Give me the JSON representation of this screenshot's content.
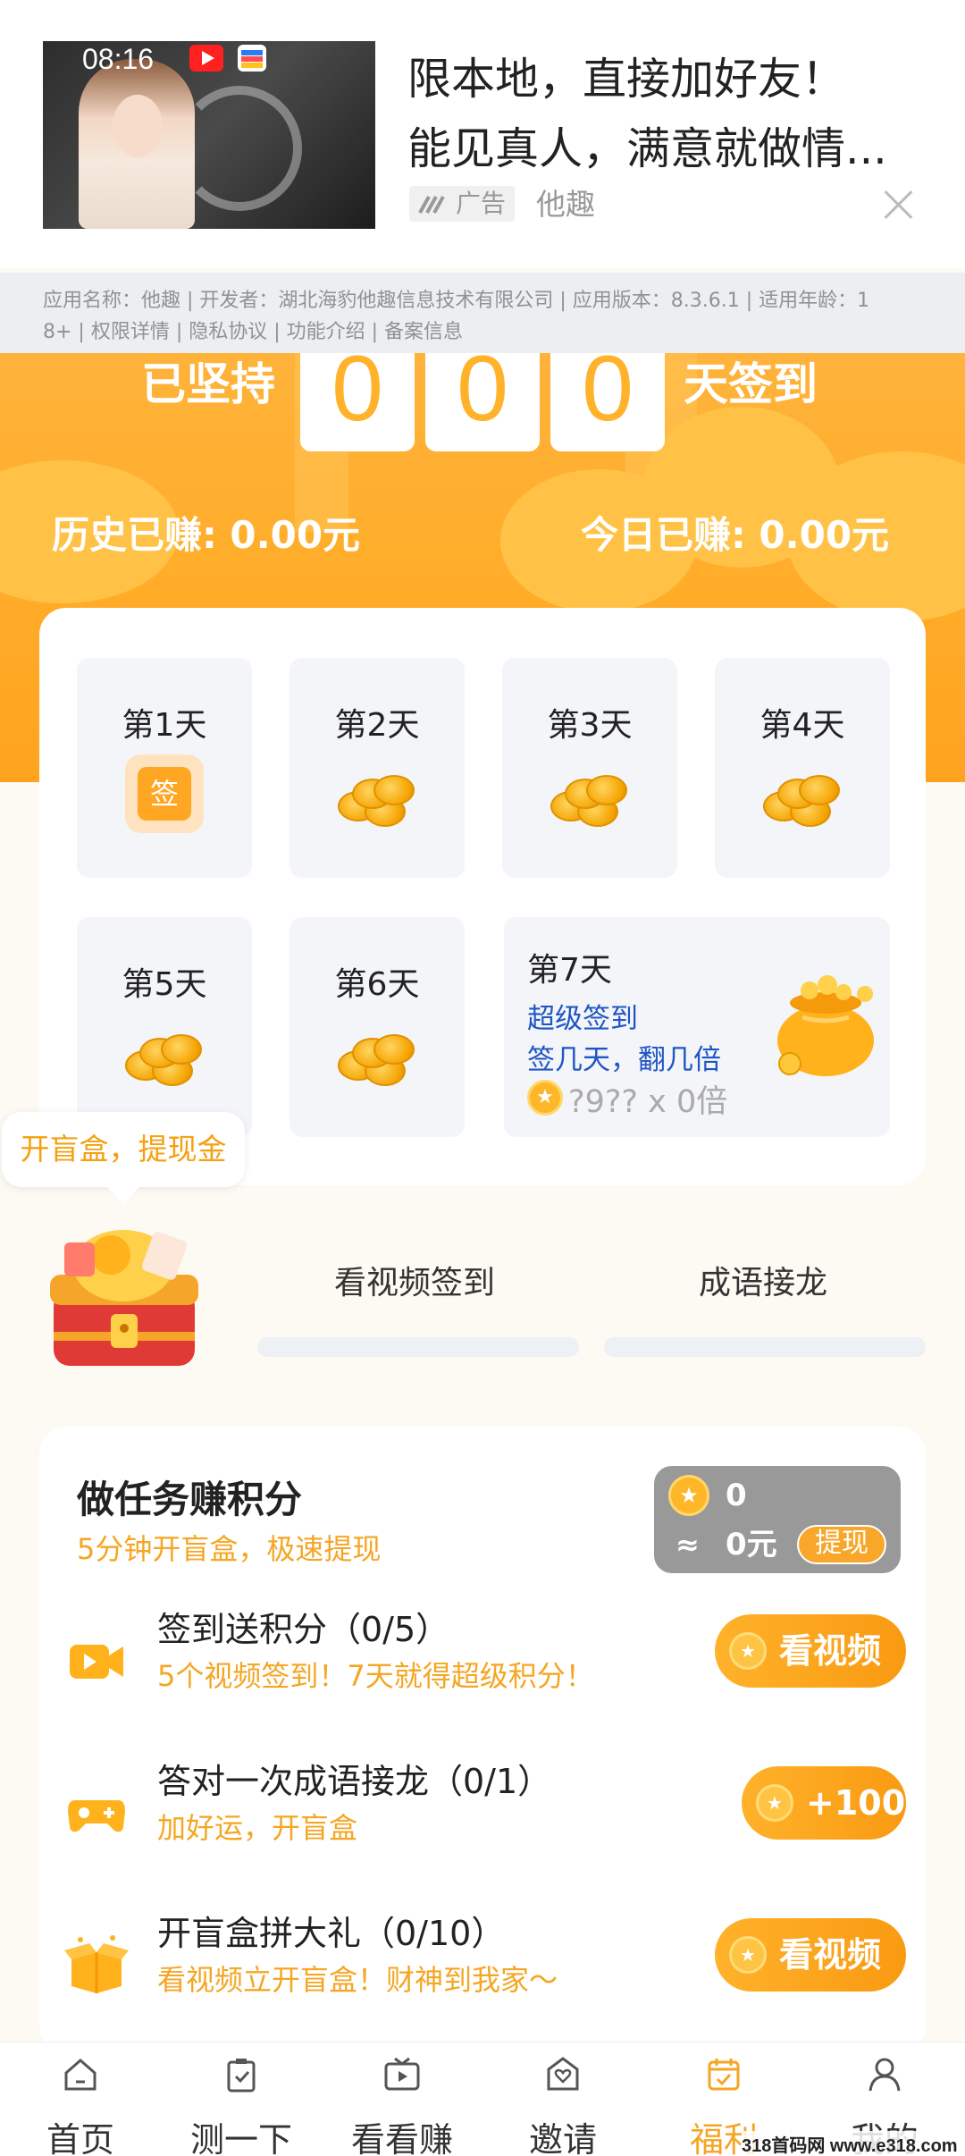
{
  "ad": {
    "time": "08:16",
    "title_line1": "限本地，直接加好友！",
    "title_line2": "能见真人，满意就做情...",
    "tag": "广告",
    "brand": "他趣",
    "info_line1": "应用名称：他趣 | 开发者：湖北海豹他趣信息技术有限公司 | 应用版本：8.3.6.1 | 适用年龄：1",
    "info_line2": "8+ | 权限详情 | 隐私协议 | 功能介绍 | 备案信息"
  },
  "streak": {
    "prefix": "已坚持",
    "digits": [
      "0",
      "0",
      "0"
    ],
    "suffix": "天签到",
    "history": "历史已赚: 0.00元",
    "today": "今日已赚: 0.00元"
  },
  "days": {
    "d1": "第1天",
    "d1_badge": "签",
    "d2": "第2天",
    "d3": "第3天",
    "d4": "第4天",
    "d5": "第5天",
    "d6": "第6天",
    "d7": "第7天",
    "d7_line1": "超级签到",
    "d7_line2": "签几天，翻几倍",
    "d7_line3": "?9?? x 0倍"
  },
  "blindbox": {
    "tooltip": "开盲盒，提现金",
    "tab1": "看视频签到",
    "tab2": "成语接龙"
  },
  "tasks": {
    "title": "做任务赚积分",
    "subtitle": "5分钟开盲盒，极速提现",
    "points": "0",
    "approx": "≈",
    "yuan": "0元",
    "withdraw": "提现",
    "items": [
      {
        "title": "签到送积分（0/5）",
        "sub": "5个视频签到！7天就得超级积分！",
        "btn": "看视频"
      },
      {
        "title": "答对一次成语接龙（0/1）",
        "sub": "加好运，开盲盒",
        "btn": "+100"
      },
      {
        "title": "开盲盒拼大礼（0/10）",
        "sub": "看视频立开盲盒！财神到我家～",
        "btn": "看视频"
      }
    ]
  },
  "nav": {
    "home": "首页",
    "test": "测一下",
    "watch": "看看赚",
    "invite": "邀请",
    "welfare": "福利",
    "mine": "我的"
  },
  "watermark": "318首码网 www.e318.com",
  "colors": {
    "accent": "#f5a623",
    "link": "#2056c4"
  }
}
